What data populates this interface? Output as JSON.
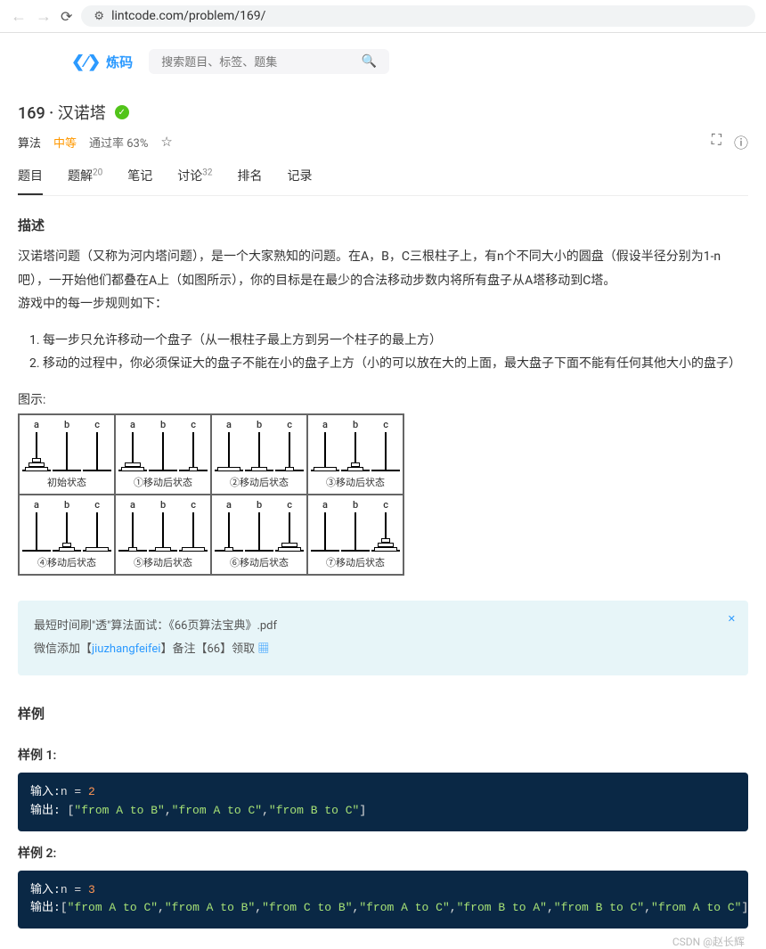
{
  "browser": {
    "url": "lintcode.com/problem/169/"
  },
  "header": {
    "logo_text": "炼码",
    "search_placeholder": "搜索题目、标签、题集"
  },
  "problem": {
    "id": "169",
    "title": "汉诺塔",
    "category": "算法",
    "difficulty": "中等",
    "pass_rate": "通过率 63%"
  },
  "tabs": [
    {
      "label": "题目",
      "count": ""
    },
    {
      "label": "题解",
      "count": "20"
    },
    {
      "label": "笔记",
      "count": ""
    },
    {
      "label": "讨论",
      "count": "32"
    },
    {
      "label": "排名",
      "count": ""
    },
    {
      "label": "记录",
      "count": ""
    }
  ],
  "sections": {
    "desc_title": "描述",
    "desc_body": "汉诺塔问题（又称为河内塔问题），是一个大家熟知的问题。在A，B，C三根柱子上，有n个不同大小的圆盘（假设半径分别为1-n吧），一开始他们都叠在A上（如图所示），你的目标是在最少的合法移动步数内将所有盘子从A塔移动到C塔。",
    "rules_intro": "游戏中的每一步规则如下：",
    "rule1": "每一步只允许移动一个盘子（从一根柱子最上方到另一个柱子的最上方）",
    "rule2": "移动的过程中，你必须保证大的盘子不能在小的盘子上方（小的可以放在大的上面，最大盘子下面不能有任何其他大小的盘子）",
    "diagram_label": "图示:"
  },
  "diagram_cells": [
    {
      "caption": "初始状态",
      "towers": [
        [
          1,
          2,
          3
        ],
        [],
        []
      ]
    },
    {
      "caption": "①移动后状态",
      "towers": [
        [
          2,
          3
        ],
        [],
        [
          1
        ]
      ]
    },
    {
      "caption": "②移动后状态",
      "towers": [
        [
          3
        ],
        [
          2
        ],
        [
          1
        ]
      ]
    },
    {
      "caption": "③移动后状态",
      "towers": [
        [
          3
        ],
        [
          1,
          2
        ],
        []
      ]
    },
    {
      "caption": "④移动后状态",
      "towers": [
        [],
        [
          1,
          2
        ],
        [
          3
        ]
      ]
    },
    {
      "caption": "⑤移动后状态",
      "towers": [
        [
          1
        ],
        [
          2
        ],
        [
          3
        ]
      ]
    },
    {
      "caption": "⑥移动后状态",
      "towers": [
        [
          1
        ],
        [],
        [
          2,
          3
        ]
      ]
    },
    {
      "caption": "⑦移动后状态",
      "towers": [
        [],
        [],
        [
          1,
          2,
          3
        ]
      ]
    }
  ],
  "tower_labels": [
    "a",
    "b",
    "c"
  ],
  "promo": {
    "line1": "最短时间刷\"透\"算法面试：《66页算法宝典》.pdf",
    "line2_prefix": "微信添加【",
    "line2_handle": "jiuzhangfeifei",
    "line2_suffix": "】备注【66】领取"
  },
  "examples_title": "样例",
  "examples": [
    {
      "label": "样例 1:",
      "input_label": "输入:",
      "input_code": "n = ",
      "input_val": "2",
      "output_label": "输出:",
      "output_parts": [
        "\"from A to B\"",
        "\"from A to C\"",
        "\"from B to C\""
      ]
    },
    {
      "label": "样例 2:",
      "input_label": "输入:",
      "input_code": "n = ",
      "input_val": "3",
      "output_label": "输出:",
      "output_parts": [
        "\"from A to C\"",
        "\"from A to B\"",
        "\"from C to B\"",
        "\"from A to C\"",
        "\"from B to A\"",
        "\"from B to C\"",
        "\"from A to C\""
      ]
    }
  ],
  "watermark": "CSDN @赵长辉"
}
